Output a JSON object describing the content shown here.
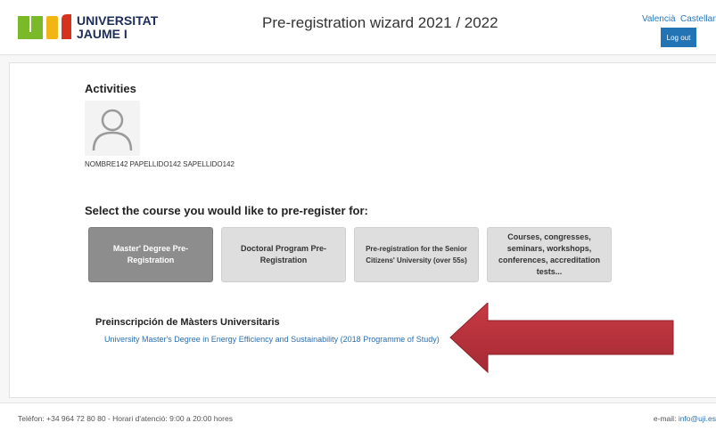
{
  "header": {
    "logo_line1": "UNIVERSITAT",
    "logo_line2": "JAUME I",
    "title": "Pre-registration wizard 2021 / 2022",
    "languages": [
      "Valencià",
      "Castellano"
    ],
    "logout_label": "Log out"
  },
  "main": {
    "section_title": "Activities",
    "user_name": "NOMBRE142 PAPELLIDO142 SAPELLIDO142",
    "select_title": "Select the course you would like to pre-register for:",
    "courses": [
      {
        "label": "Master' Degree Pre-Registration",
        "selected": true
      },
      {
        "label": "Doctoral Program Pre-Registration",
        "selected": false
      },
      {
        "label": "Pre-registration for the Senior Citizens' University (over 55s)",
        "selected": false
      },
      {
        "label": "Courses, congresses, seminars, workshops, conferences, accreditation tests...",
        "selected": false
      }
    ],
    "prereg_title": "Preinscripción de Màsters Universitaris",
    "degree_link": "University Master's Degree in Energy Efficiency and Sustainability (2018 Programme of Study)"
  },
  "footer": {
    "contact": "Teléfon: +34 964 72 80 80 - Horari d'atenció: 9:00 a 20:00 hores",
    "email_label": "e-mail:",
    "email": "info@uji.es"
  },
  "colors": {
    "accent": "#2274b5",
    "logo_green": "#7ab928",
    "logo_yellow": "#f1b514",
    "logo_red": "#d6331f",
    "arrow": "#b7323c"
  }
}
